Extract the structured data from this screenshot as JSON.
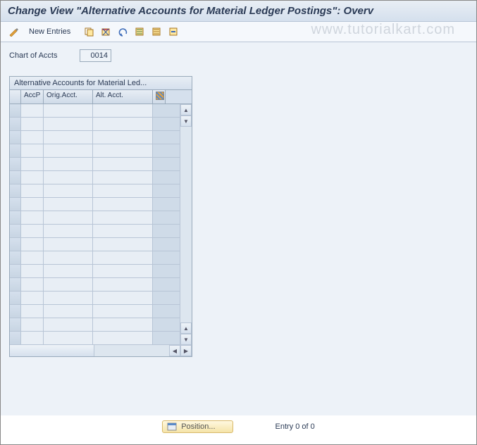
{
  "title": "Change View \"Alternative Accounts for Material Ledger Postings\": Overv",
  "toolbar": {
    "new_entries": "New Entries"
  },
  "watermark": "www.tutorialkart.com",
  "fields": {
    "chart_of_accts_label": "Chart of Accts",
    "chart_of_accts_value": "0014"
  },
  "table": {
    "title": "Alternative Accounts for Material Led...",
    "columns": {
      "accp": "AccP",
      "orig": "Orig.Acct.",
      "alt": "Alt. Acct."
    }
  },
  "footer": {
    "position_label": "Position...",
    "entry_text": "Entry 0 of 0"
  }
}
